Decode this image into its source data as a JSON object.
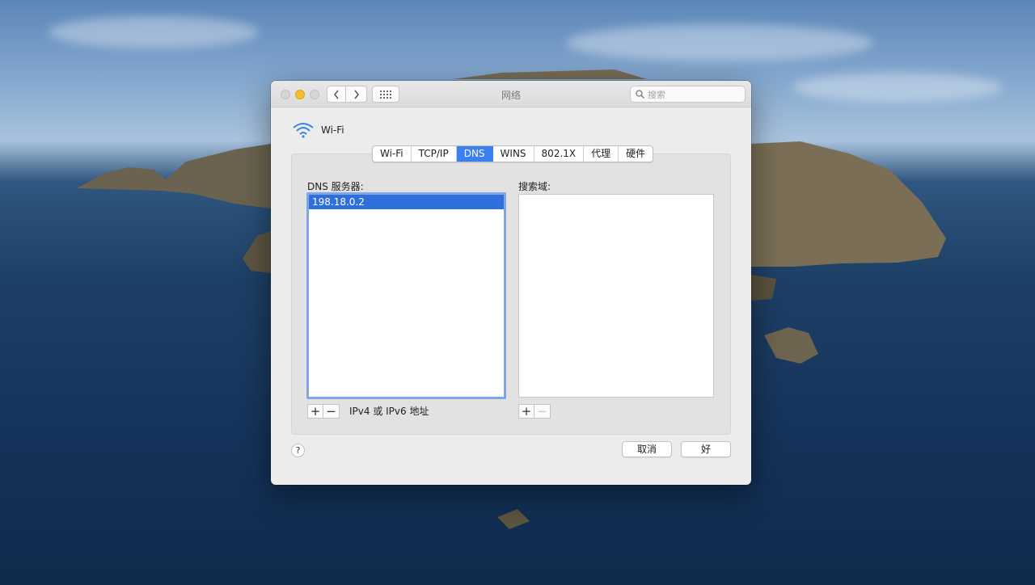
{
  "window": {
    "title": "网络",
    "search_placeholder": "搜索"
  },
  "interface": {
    "name": "Wi-Fi",
    "icon": "wifi-icon"
  },
  "tabs": [
    {
      "label": "Wi-Fi",
      "active": false
    },
    {
      "label": "TCP/IP",
      "active": false
    },
    {
      "label": "DNS",
      "active": true
    },
    {
      "label": "WINS",
      "active": false
    },
    {
      "label": "802.1X",
      "active": false
    },
    {
      "label": "代理",
      "active": false
    },
    {
      "label": "硬件",
      "active": false
    }
  ],
  "dns": {
    "servers_label": "DNS 服务器:",
    "servers": [
      "198.18.0.2"
    ],
    "hint": "IPv4 或 IPv6 地址",
    "add": "+",
    "remove": "−"
  },
  "search_domains": {
    "label": "搜索域:",
    "items": [],
    "add": "+",
    "remove": "−"
  },
  "footer": {
    "help": "?",
    "cancel": "取消",
    "ok": "好"
  },
  "colors": {
    "accent": "#3b80f2",
    "selection": "#2f6fdc",
    "minimize": "#f6be2f"
  }
}
